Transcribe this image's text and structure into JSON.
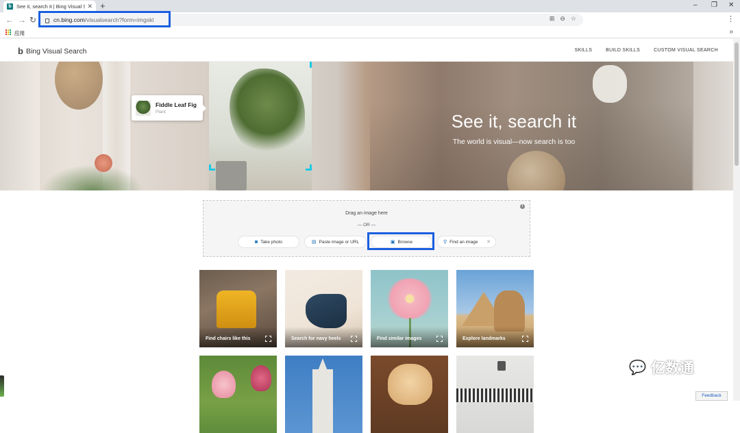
{
  "browser": {
    "tab_title": "See it, search it | Bing Visual Search",
    "new_tab": "+",
    "url_host": "cn.bing.com",
    "url_path": "/visualsearch?form=imgskl",
    "bookmarks_apps": "应用",
    "bookmarks_more": "»",
    "window_controls": [
      "–",
      "❐",
      "✕"
    ]
  },
  "header": {
    "logo_mark": "b",
    "logo_text": "Bing Visual Search",
    "nav": [
      "SKILLS",
      "BUILD SKILLS",
      "CUSTOM VISUAL SEARCH"
    ]
  },
  "hero": {
    "title": "See it, search it",
    "subtitle": "The world is visual—now search is too",
    "tag_name": "Fiddle Leaf Fig",
    "tag_category": "Plant"
  },
  "upload": {
    "drag_text": "Drag an image here",
    "or_text": "— OR —",
    "take_photo": "Take photo",
    "paste": "Paste image or URL",
    "browse": "Browse",
    "find": "Find an image"
  },
  "tiles": [
    {
      "label": "Find chairs like this"
    },
    {
      "label": "Search for navy heels"
    },
    {
      "label": "Find similar images"
    },
    {
      "label": "Explore landmarks"
    },
    {
      "label": ""
    },
    {
      "label": ""
    },
    {
      "label": ""
    },
    {
      "label": ""
    }
  ],
  "watermark": "亿数通",
  "feedback": "Feedback",
  "colors": {
    "highlight": "#1a5fe0",
    "accent_icon": "#1a6fb8",
    "corner_marker": "#1ec8e6"
  }
}
